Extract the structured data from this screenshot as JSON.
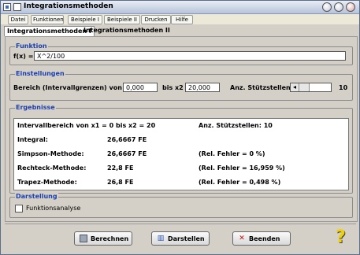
{
  "window": {
    "title": "Integrationsmethoden"
  },
  "menu": [
    "Datei",
    "Funktionen",
    "Beispiele I",
    "Beispiele II",
    "Drucken",
    "Hilfe"
  ],
  "tabs": [
    "Integrationsmethoden I",
    "Integrationsmethoden II"
  ],
  "funktion": {
    "group_label": "Funktion",
    "label": "f(x) =",
    "value": "X^2/100"
  },
  "einstellungen": {
    "group_label": "Einstellungen",
    "bereich_label": "Bereich (Intervallgrenzen) von x1 =",
    "x1_value": "0,000",
    "x2_label": "bis x2 =",
    "x2_value": "20,000",
    "stuetz_label": "Anz. Stützstellen:",
    "stuetz_value": "10"
  },
  "ergebnisse": {
    "group_label": "Ergebnisse",
    "intervall": "Intervallbereich von x1 = 0 bis x2 = 20",
    "anz": "Anz. Stützstellen: 10",
    "rows": [
      {
        "name": "Integral:",
        "value": "26,6667 FE",
        "fehler": ""
      },
      {
        "name": "Simpson-Methode:",
        "value": "26,6667 FE",
        "fehler": "(Rel. Fehler = 0 %)"
      },
      {
        "name": "Rechteck-Methode:",
        "value": "22,8 FE",
        "fehler": "(Rel. Fehler = 16,959 %)"
      },
      {
        "name": "Trapez-Methode:",
        "value": "26,8 FE",
        "fehler": "(Rel. Fehler = 0,498 %)"
      }
    ]
  },
  "darstellung": {
    "group_label": "Darstellung",
    "checkbox_label": "Funktionsanalyse"
  },
  "buttons": {
    "berechnen": "Berechnen",
    "darstellen": "Darstellen",
    "beenden": "Beenden"
  }
}
